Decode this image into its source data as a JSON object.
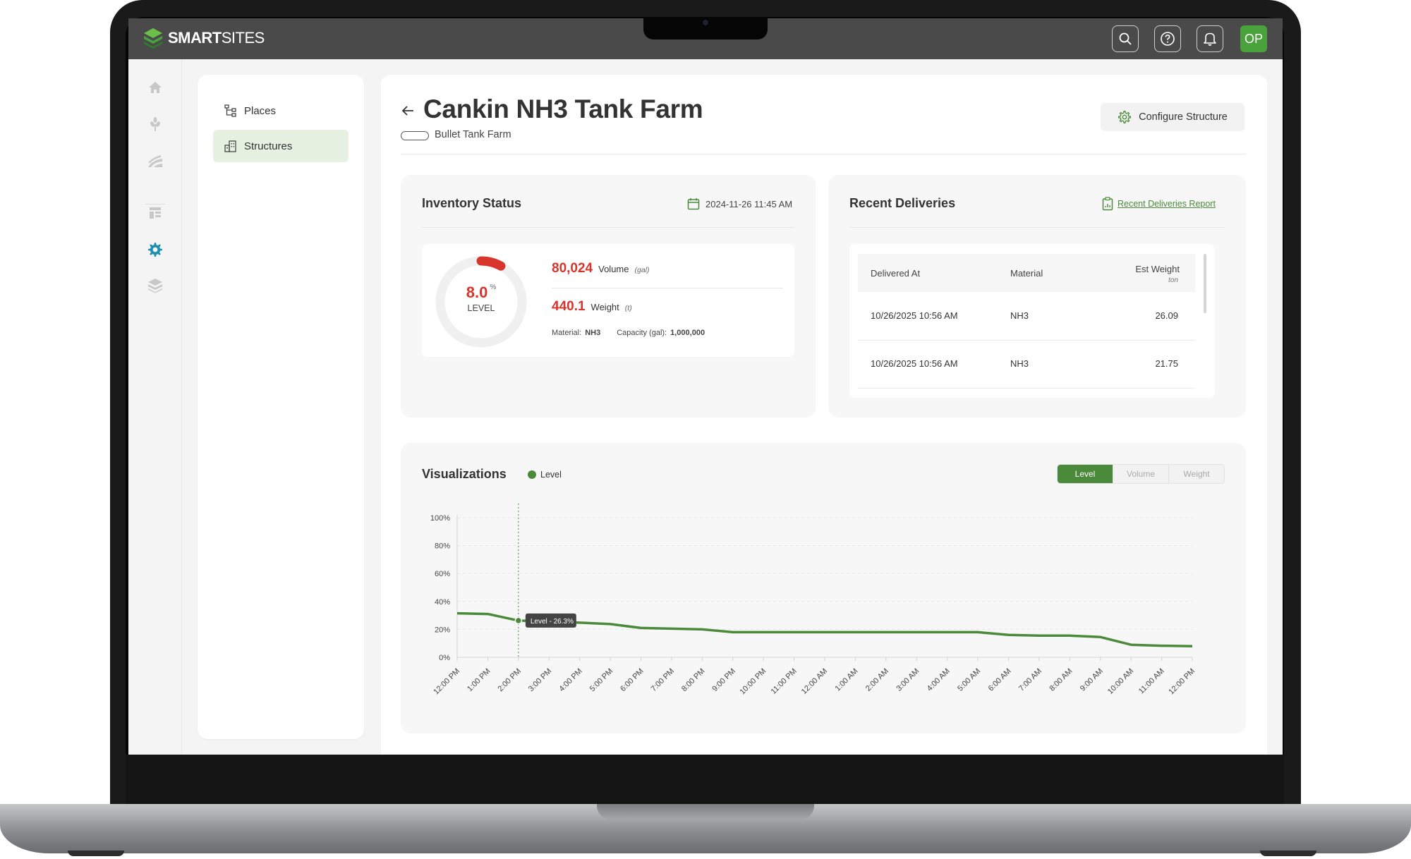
{
  "app": {
    "logo_text_a": "SMART",
    "logo_text_b": "SITES",
    "user_initials": "OP",
    "brand_color": "#4aa23c"
  },
  "topbar_icons": [
    "search-icon",
    "help-icon",
    "bell-icon"
  ],
  "subnav": {
    "items": [
      {
        "label": "Places",
        "icon": "hierarchy-icon",
        "active": false
      },
      {
        "label": "Structures",
        "icon": "building-icon",
        "active": true
      }
    ]
  },
  "page": {
    "title": "Cankin NH3 Tank Farm",
    "subtitle": "Bullet Tank Farm",
    "configure_label": "Configure Structure"
  },
  "inventory": {
    "title": "Inventory Status",
    "timestamp": "2024-11-26 11:45 AM",
    "level_value": "8.0",
    "level_unit": "%",
    "level_label": "LEVEL",
    "level_fraction": 0.08,
    "volume_value": "80,024",
    "volume_label": "Volume",
    "volume_unit": "(gal)",
    "weight_value": "440.1",
    "weight_label": "Weight",
    "weight_unit": "(t)",
    "material_label": "Material:",
    "material_value": "NH3",
    "capacity_label": "Capacity (gal):",
    "capacity_value": "1,000,000"
  },
  "deliveries": {
    "title": "Recent Deliveries",
    "report_link": "Recent Deliveries Report",
    "columns": {
      "delivered_at": "Delivered At",
      "material": "Material",
      "est_weight": "Est Weight",
      "est_weight_unit": "ton"
    },
    "rows": [
      {
        "delivered_at": "10/26/2025 10:56 AM",
        "material": "NH3",
        "est_weight": "26.09"
      },
      {
        "delivered_at": "10/26/2025 10:56 AM",
        "material": "NH3",
        "est_weight": "21.75"
      }
    ]
  },
  "visualizations": {
    "title": "Visualizations",
    "legend": "Level",
    "tabs": [
      {
        "label": "Level",
        "active": true
      },
      {
        "label": "Volume",
        "active": false
      },
      {
        "label": "Weight",
        "active": false
      }
    ],
    "tooltip": "Level - 26.3%"
  },
  "chart_data": {
    "type": "line",
    "title": "",
    "xlabel": "",
    "ylabel": "",
    "y_tick_labels": [
      "0%",
      "20%",
      "40%",
      "60%",
      "80%",
      "100%"
    ],
    "ylim": [
      0,
      100
    ],
    "grid": true,
    "line_color": "#4a8a3a",
    "categories": [
      "12:00 PM",
      "1:00 PM",
      "2:00 PM",
      "3:00 PM",
      "4:00 PM",
      "5:00 PM",
      "6:00 PM",
      "7:00 PM",
      "8:00 PM",
      "9:00 PM",
      "10:00 PM",
      "11:00 PM",
      "12:00 AM",
      "1:00 AM",
      "2:00 AM",
      "3:00 AM",
      "4:00 AM",
      "5:00 AM",
      "6:00 AM",
      "7:00 AM",
      "8:00 AM",
      "9:00 AM",
      "10:00 AM",
      "11:00 AM",
      "12:00 PM"
    ],
    "series": [
      {
        "name": "Level",
        "values": [
          31.5,
          31,
          26.3,
          25.5,
          24.8,
          23.8,
          21,
          20.5,
          20,
          18,
          18,
          18,
          18,
          18,
          18,
          18,
          18,
          18,
          16,
          15.5,
          15.5,
          14.5,
          9,
          8.3,
          8
        ]
      }
    ],
    "highlight_index": 2
  }
}
